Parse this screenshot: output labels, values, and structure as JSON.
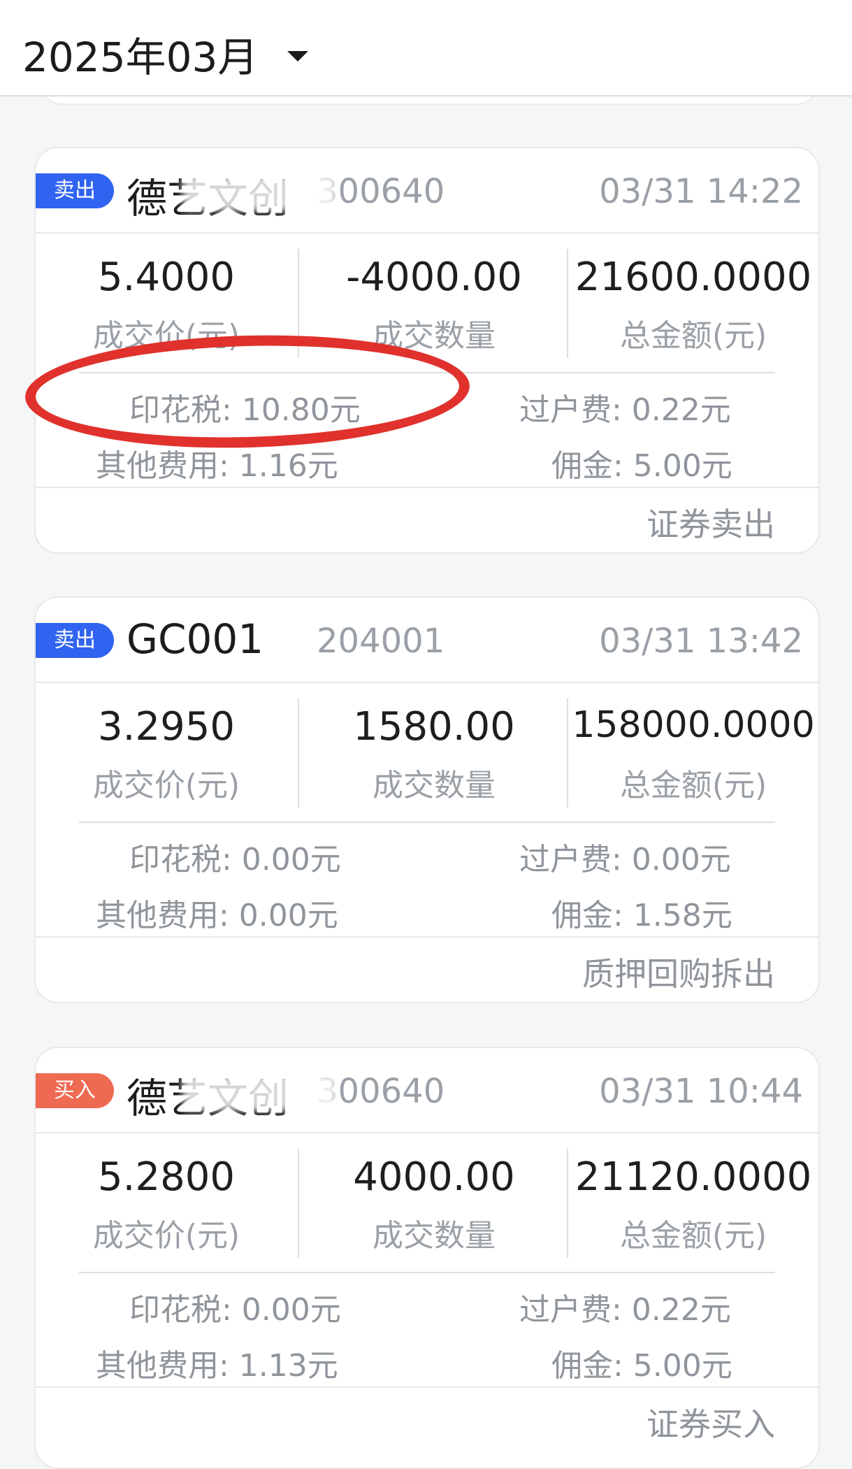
{
  "header": {
    "month": "2025年03月"
  },
  "trades": [
    {
      "side": "卖出",
      "side_kind": "sell",
      "name": "德艺文创",
      "code": "300640",
      "time": "03/31 14:22",
      "price": "5.4000",
      "price_label": "成交价(元)",
      "quantity": "-4000.00",
      "quantity_label": "成交数量",
      "amount": "21600.0000",
      "amount_label": "总金额(元)",
      "stamp_tax": "印花税: 10.80元",
      "transfer_fee": "过户费: 0.22元",
      "other_fees": "其他费用: 1.16元",
      "commission": "佣金: 5.00元",
      "type": "证券卖出"
    },
    {
      "side": "卖出",
      "side_kind": "sell",
      "name": "GC001",
      "code": "204001",
      "time": "03/31 13:42",
      "price": "3.2950",
      "price_label": "成交价(元)",
      "quantity": "1580.00",
      "quantity_label": "成交数量",
      "amount": "158000.0000",
      "amount_label": "总金额(元)",
      "stamp_tax": "印花税: 0.00元",
      "transfer_fee": "过户费: 0.00元",
      "other_fees": "其他费用: 0.00元",
      "commission": "佣金: 1.58元",
      "type": "质押回购拆出"
    },
    {
      "side": "买入",
      "side_kind": "buy",
      "name": "德艺文创",
      "code": "300640",
      "time": "03/31 10:44",
      "price": "5.2800",
      "price_label": "成交价(元)",
      "quantity": "4000.00",
      "quantity_label": "成交数量",
      "amount": "21120.0000",
      "amount_label": "总金额(元)",
      "stamp_tax": "印花税: 0.00元",
      "transfer_fee": "过户费: 0.22元",
      "other_fees": "其他费用: 1.13元",
      "commission": "佣金: 5.00元",
      "type": "证券买入"
    }
  ],
  "colors": {
    "sell_badge": "#2f63f0",
    "buy_badge": "#ee6a52",
    "annotation_circle": "#e0312c"
  }
}
